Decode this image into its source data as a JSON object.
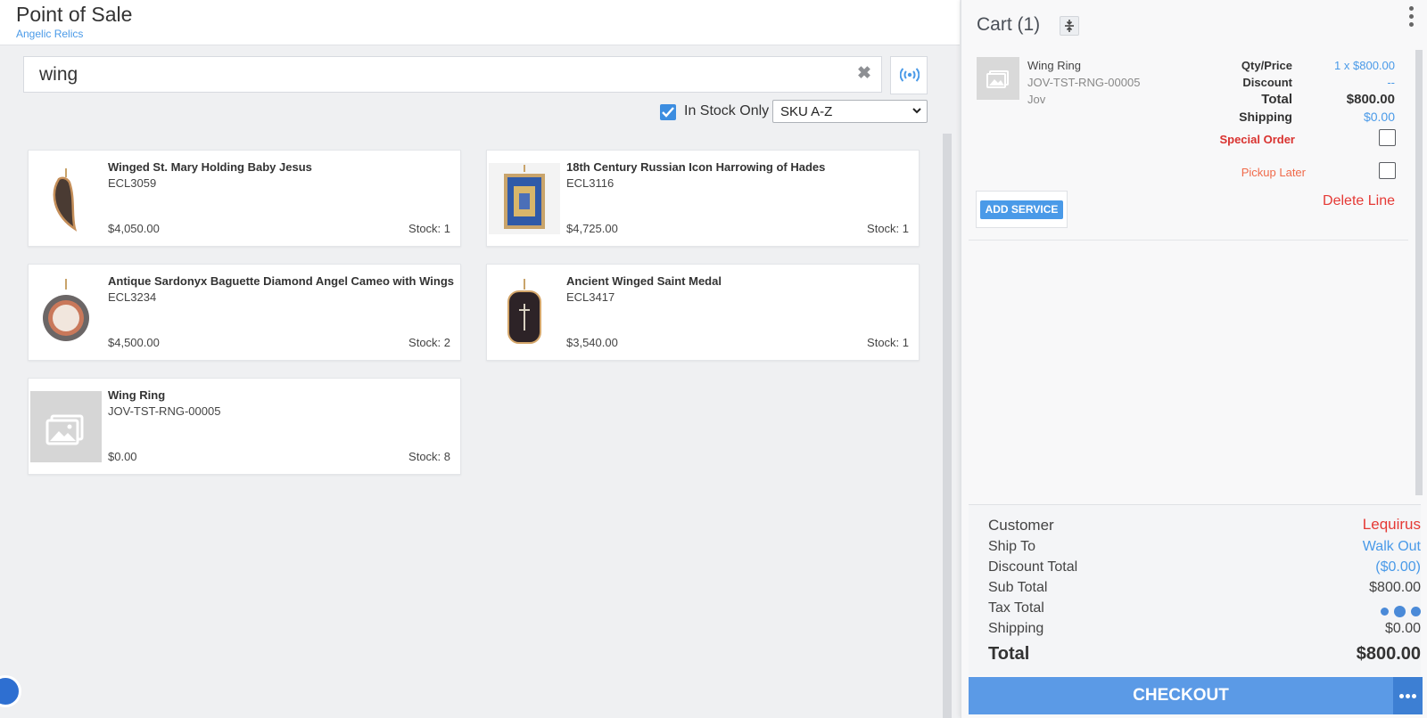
{
  "header": {
    "title": "Point of Sale",
    "subtitle": "Angelic Relics"
  },
  "search": {
    "value": "wing",
    "placeholder": ""
  },
  "filters": {
    "in_stock_label": "In Stock Only",
    "in_stock_checked": true,
    "sort_selected": "SKU A-Z"
  },
  "products": [
    {
      "name": "Winged St. Mary Holding Baby Jesus",
      "sku": "ECL3059",
      "price": "$4,050.00",
      "stock": "Stock: 1"
    },
    {
      "name": "18th Century Russian Icon Harrowing of Hades",
      "sku": "ECL3116",
      "price": "$4,725.00",
      "stock": "Stock: 1"
    },
    {
      "name": "Antique Sardonyx Baguette Diamond Angel Cameo with Wings",
      "sku": "ECL3234",
      "price": "$4,500.00",
      "stock": "Stock: 2"
    },
    {
      "name": "Ancient Winged Saint Medal",
      "sku": "ECL3417",
      "price": "$3,540.00",
      "stock": "Stock: 1"
    },
    {
      "name": "Wing Ring",
      "sku": "JOV-TST-RNG-00005",
      "price": "$0.00",
      "stock": "Stock: 8"
    }
  ],
  "cart": {
    "title": "Cart (1)",
    "line": {
      "name": "Wing Ring",
      "sku": "JOV-TST-RNG-00005",
      "brand": "Jov",
      "qty_price_label": "Qty/Price",
      "qty_price_value": "1 x $800.00",
      "discount_label": "Discount",
      "discount_value": "--",
      "total_label": "Total",
      "total_value": "$800.00",
      "shipping_label": "Shipping",
      "shipping_value": "$0.00",
      "special_order_label": "Special Order",
      "pickup_later_label": "Pickup Later",
      "add_service_label": "ADD SERVICE",
      "delete_line_label": "Delete Line"
    },
    "summary": {
      "customer_label": "Customer",
      "customer_value": "Lequirus",
      "ship_to_label": "Ship To",
      "ship_to_value": "Walk Out",
      "discount_total_label": "Discount Total",
      "discount_total_value": "($0.00)",
      "sub_total_label": "Sub Total",
      "sub_total_value": "$800.00",
      "tax_total_label": "Tax Total",
      "shipping_label": "Shipping",
      "shipping_value": "$0.00",
      "total_label": "Total",
      "total_value": "$800.00"
    },
    "checkout_label": "CHECKOUT"
  },
  "colors": {
    "accent": "#4a9ae8",
    "danger": "#e53935",
    "checkout": "#5b9ae6"
  }
}
